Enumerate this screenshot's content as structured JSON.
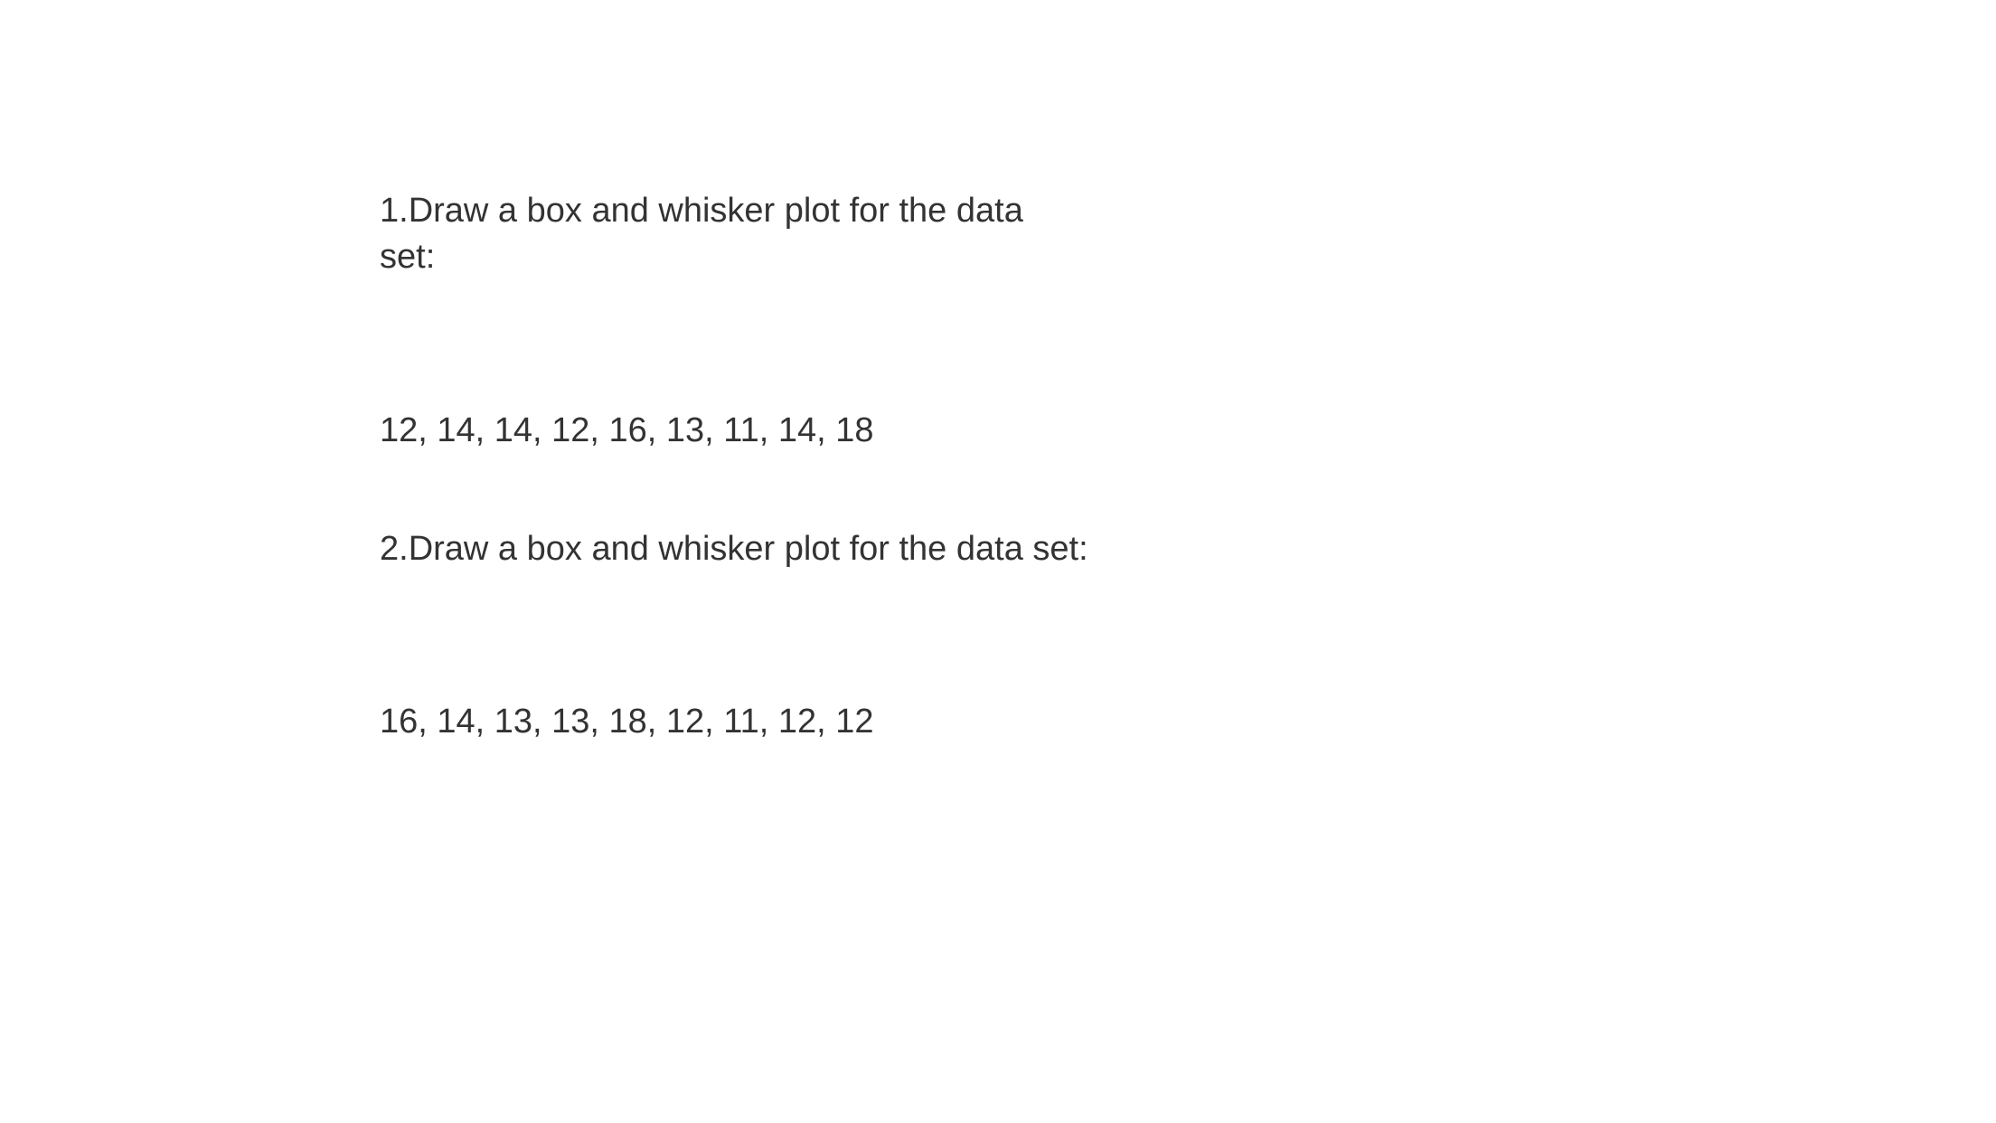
{
  "question1": {
    "line1": "1.Draw a box and whisker plot for the data",
    "line2": "set:",
    "data": "12, 14, 14, 12, 16, 13, 11, 14, 18"
  },
  "question2": {
    "prompt": "2.Draw a box and whisker plot for the data set:",
    "data": "16, 14, 13, 13, 18, 12, 11, 12, 12"
  }
}
